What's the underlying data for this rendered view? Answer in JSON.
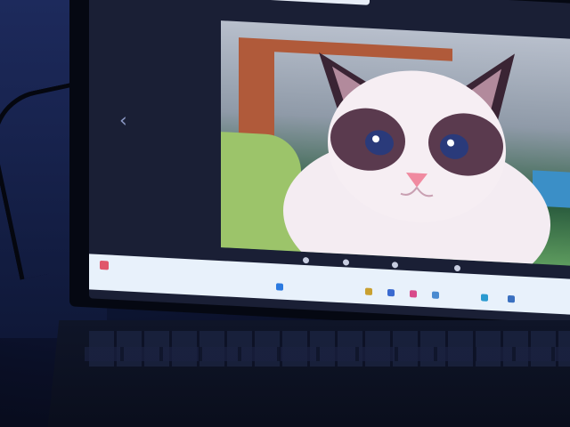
{
  "photo": {
    "subject": "ragdoll-cat",
    "colors": {
      "fur": "#f4ecf2",
      "mask": "#5a3a4e",
      "eyes": "#2a3a7a",
      "nose": "#f08aa0"
    }
  },
  "viewer": {
    "prev_icon": "chevron-left-icon",
    "title": "",
    "subtitle": "",
    "controls": [
      {
        "icon": "copy-icon",
        "label": ""
      },
      {
        "icon": "search-icon",
        "label": ""
      },
      {
        "icon": "share-icon",
        "label": ""
      },
      {
        "icon": "more-icon",
        "label": ""
      }
    ]
  },
  "taskbar": {
    "weather_icon": "weather-icon",
    "tray_icons": [
      "start-icon",
      "search-icon",
      "chat-icon",
      "explorer-icon",
      "store-icon",
      "edge-icon",
      "settings-icon"
    ]
  }
}
